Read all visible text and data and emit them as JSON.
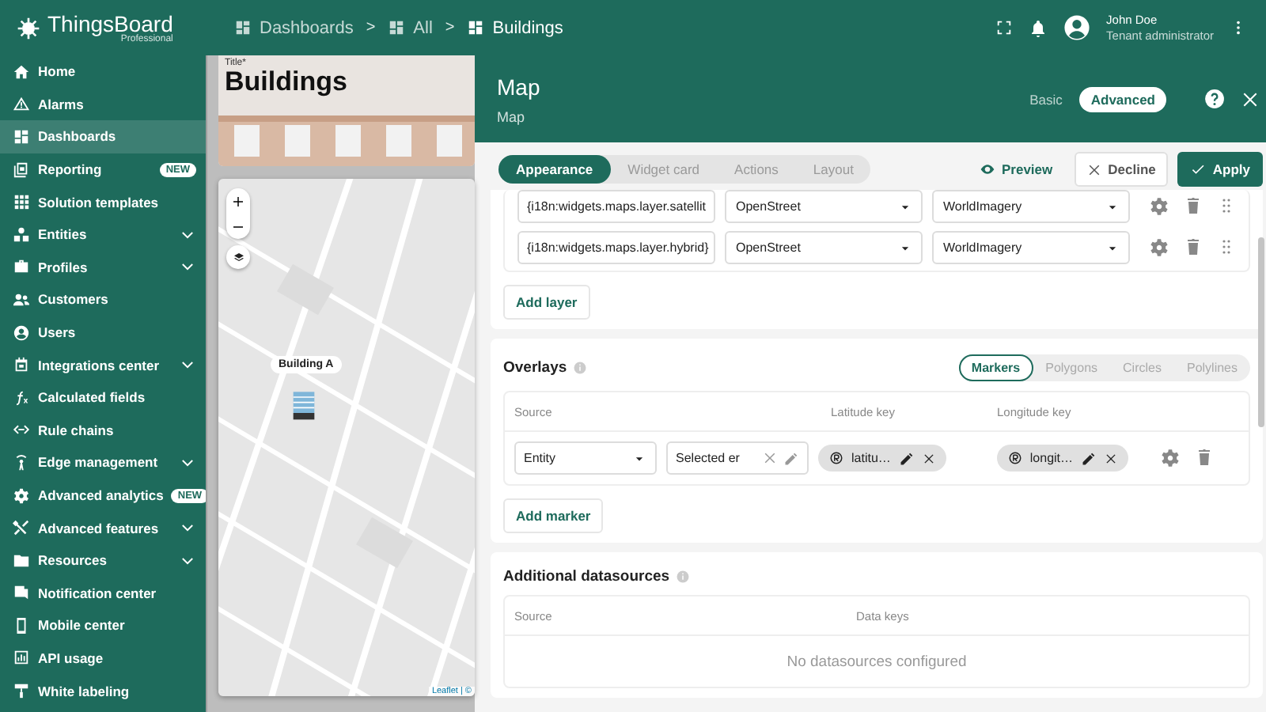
{
  "header": {
    "logo": {
      "name": "ThingsBoard",
      "edition": "Professional"
    },
    "breadcrumb": [
      {
        "kind": "crumb",
        "label": "Dashboards"
      },
      {
        "kind": "separator",
        "label": ">"
      },
      {
        "kind": "crumb",
        "label": "All"
      },
      {
        "kind": "separator",
        "label": ">"
      },
      {
        "kind": "current",
        "label": "Buildings"
      }
    ],
    "user": {
      "name": "John Doe",
      "role": "Tenant administrator"
    }
  },
  "sidebar": {
    "items": [
      {
        "label": "Home",
        "selected": false,
        "expandable": false
      },
      {
        "label": "Alarms",
        "selected": false,
        "expandable": false
      },
      {
        "label": "Dashboards",
        "selected": true,
        "expandable": false
      },
      {
        "label": "Reporting",
        "selected": false,
        "expandable": false,
        "badge": "NEW"
      },
      {
        "label": "Solution templates",
        "selected": false,
        "expandable": false
      },
      {
        "label": "Entities",
        "selected": false,
        "expandable": true
      },
      {
        "label": "Profiles",
        "selected": false,
        "expandable": true
      },
      {
        "label": "Customers",
        "selected": false,
        "expandable": false
      },
      {
        "label": "Users",
        "selected": false,
        "expandable": false
      },
      {
        "label": "Integrations center",
        "selected": false,
        "expandable": true
      },
      {
        "label": "Calculated fields",
        "selected": false,
        "expandable": false
      },
      {
        "label": "Rule chains",
        "selected": false,
        "expandable": false
      },
      {
        "label": "Edge management",
        "selected": false,
        "expandable": true
      },
      {
        "label": "Advanced analytics",
        "selected": false,
        "expandable": false,
        "badge": "NEW"
      },
      {
        "label": "Advanced features",
        "selected": false,
        "expandable": true
      },
      {
        "label": "Resources",
        "selected": false,
        "expandable": true
      },
      {
        "label": "Notification center",
        "selected": false,
        "expandable": false
      },
      {
        "label": "Mobile center",
        "selected": false,
        "expandable": false
      },
      {
        "label": "API usage",
        "selected": false,
        "expandable": false
      },
      {
        "label": "White labeling",
        "selected": false,
        "expandable": false
      }
    ]
  },
  "dashboard": {
    "title_label": "Title*",
    "title": "Buildings",
    "map": {
      "marker_label": "Building A",
      "attribution": "Leaflet | ©"
    }
  },
  "dialog": {
    "title": "Map",
    "subtitle": "Map",
    "modes": [
      {
        "label": "Basic",
        "selected": false
      },
      {
        "label": "Advanced",
        "selected": true
      }
    ],
    "tabs": [
      {
        "label": "Appearance",
        "selected": true
      },
      {
        "label": "Widget card",
        "selected": false
      },
      {
        "label": "Actions",
        "selected": false
      },
      {
        "label": "Layout",
        "selected": false
      }
    ],
    "actions": [
      {
        "kind": "preview",
        "label": "Preview"
      },
      {
        "kind": "decline",
        "label": "Decline"
      },
      {
        "kind": "apply",
        "label": "Apply"
      }
    ],
    "layers": {
      "rows": [
        {
          "label": "{i18n:widgets.maps.layer.satellit",
          "provider": "OpenStreet",
          "layer": "WorldImagery"
        },
        {
          "label": "{i18n:widgets.maps.layer.hybrid}",
          "provider": "OpenStreet",
          "layer": "WorldImagery"
        }
      ],
      "add_button": "Add layer"
    },
    "overlays": {
      "title": "Overlays",
      "types": [
        {
          "label": "Markers",
          "selected": true
        },
        {
          "label": "Polygons",
          "selected": false
        },
        {
          "label": "Circles",
          "selected": false
        },
        {
          "label": "Polylines",
          "selected": false
        }
      ],
      "columns": [
        "Source",
        "Latitude key",
        "Longitude key"
      ],
      "rows": [
        {
          "source_type": "Entity",
          "source": "Selected er",
          "latitude_key": "latitu…",
          "longitude_key": "longit…"
        }
      ],
      "add_button": "Add marker"
    },
    "additional": {
      "title": "Additional datasources",
      "columns": [
        "Source",
        "Data keys"
      ],
      "empty": "No datasources configured"
    }
  }
}
